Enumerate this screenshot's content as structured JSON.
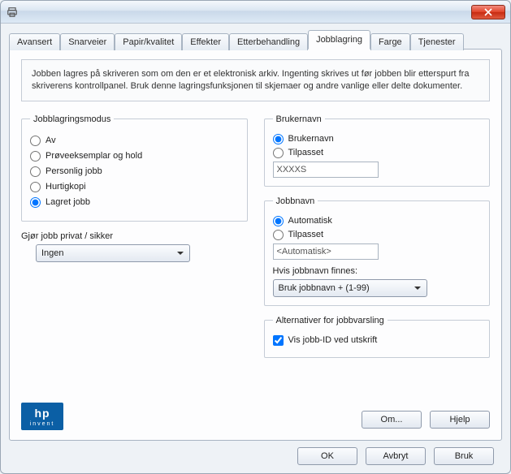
{
  "tabs": [
    "Avansert",
    "Snarveier",
    "Papir/kvalitet",
    "Effekter",
    "Etterbehandling",
    "Jobblagring",
    "Farge",
    "Tjenester"
  ],
  "active_tab": 5,
  "description": "Jobben lagres på skriveren som om den er et elektronisk arkiv. Ingenting skrives ut før jobben blir etterspurt fra skriverens kontrollpanel. Bruk denne lagringsfunksjonen til skjemaer og andre vanlige eller delte dokumenter.",
  "mode": {
    "legend": "Jobblagringsmodus",
    "options": [
      "Av",
      "Prøveeksemplar og hold",
      "Personlig jobb",
      "Hurtigkopi",
      "Lagret jobb"
    ],
    "selected": 4
  },
  "private": {
    "label": "Gjør jobb privat / sikker",
    "value": "Ingen"
  },
  "username": {
    "legend": "Brukernavn",
    "opt_user": "Brukernavn",
    "opt_custom": "Tilpasset",
    "selected": 0,
    "value": "XXXXS"
  },
  "jobname": {
    "legend": "Jobbnavn",
    "opt_auto": "Automatisk",
    "opt_custom": "Tilpasset",
    "selected": 0,
    "value": "<Automatisk>",
    "exists_label": "Hvis jobbnavn finnes:",
    "exists_value": "Bruk jobbnavn + (1-99)"
  },
  "notify": {
    "legend": "Alternativer for jobbvarsling",
    "show_id": "Vis jobb-ID ved utskrift",
    "checked": true
  },
  "logo": {
    "brand": "hp",
    "tagline": "invent"
  },
  "panel_buttons": {
    "about": "Om...",
    "help": "Hjelp"
  },
  "dialog_buttons": {
    "ok": "OK",
    "cancel": "Avbryt",
    "apply": "Bruk"
  }
}
